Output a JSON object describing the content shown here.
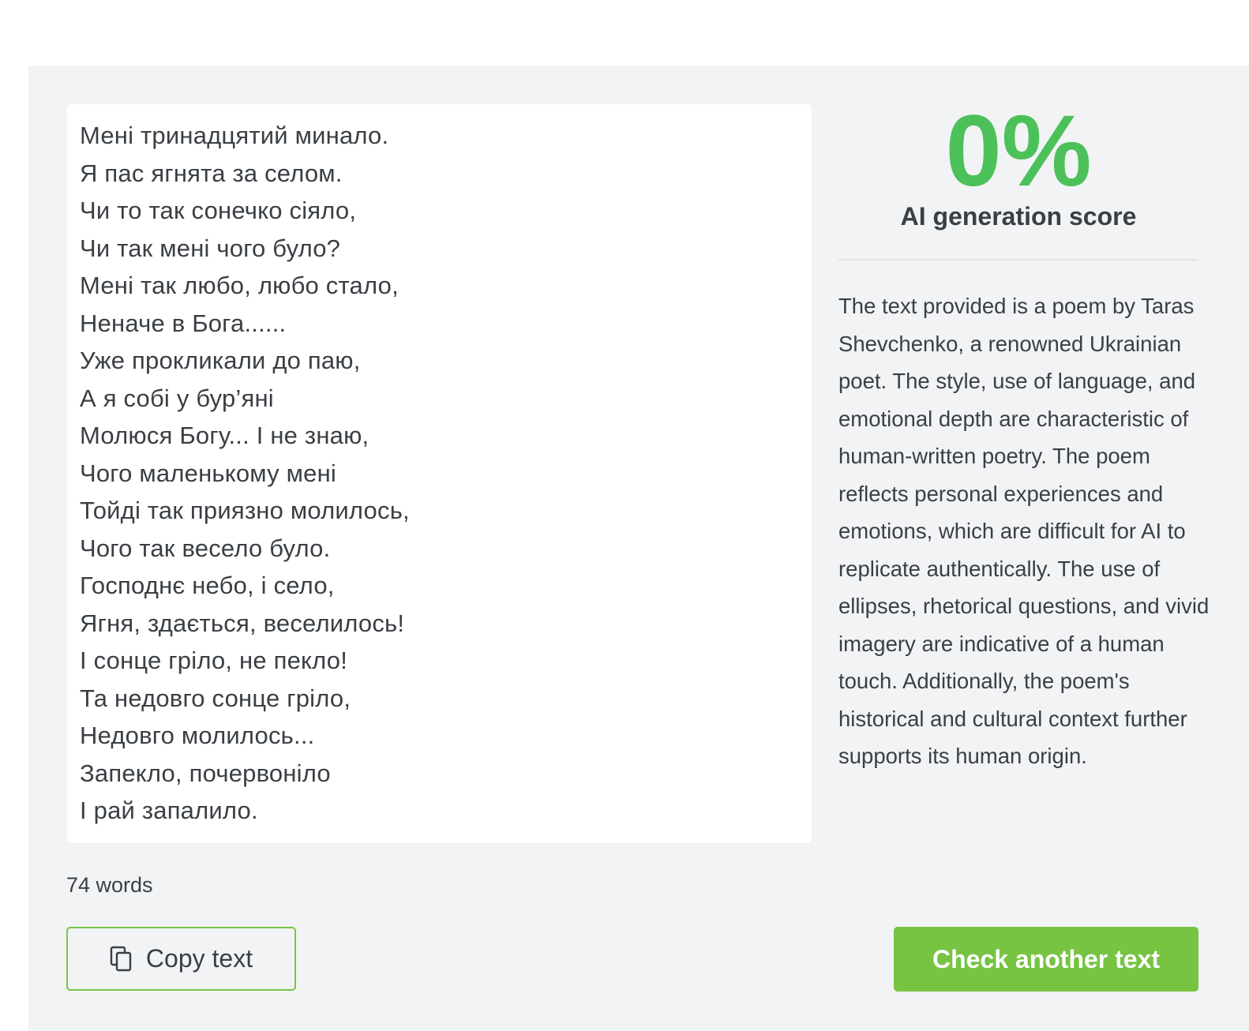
{
  "input_text": {
    "lines": [
      "Мені тринадцятий минало.",
      "Я пас ягнята за селом.",
      "Чи то так сонечко сіяло,",
      "Чи так мені чого було?",
      "Мені так любо, любо стало,",
      "Неначе в Бога......",
      "Уже прокликали до паю,",
      "А я собі у бур’яні",
      "Молюся Богу... І не знаю,",
      "Чого маленькому мені",
      "Тойді так приязно молилось,",
      "Чого так весело було.",
      "Господнє небо, і село,",
      "Ягня, здається, веселилось!",
      "І сонце гріло, не пекло!",
      "Та недовго сонце гріло,",
      "Недовго молилось...",
      "Запекло, почервоніло",
      "І рай запалило."
    ],
    "word_count": "74 words"
  },
  "actions": {
    "copy_label": "Copy text",
    "copy_icon": "copy-icon",
    "check_another_label": "Check another text"
  },
  "result": {
    "score": "0%",
    "score_label": "AI generation score",
    "score_color": "#4cc159",
    "explanation": "The text provided is a poem by Taras Shevchenko, a renowned Ukrainian poet. The style, use of language, and emotional depth are characteristic of human-written poetry. The poem reflects personal experiences and emotions, which are difficult for AI to replicate authentically. The use of ellipses, rhetorical questions, and vivid imagery are indicative of a human touch. Additionally, the poem's historical and cultural context further supports its human origin."
  },
  "colors": {
    "accent": "#76c442",
    "panel_background": "#f2f3f5"
  }
}
